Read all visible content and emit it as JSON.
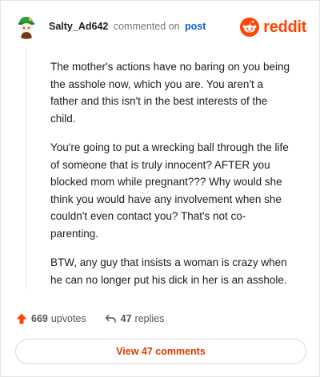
{
  "header": {
    "username": "Salty_Ad642",
    "action_text": "commented on",
    "link_text": "post",
    "brand_name": "reddit",
    "brand_color": "#ff4500"
  },
  "comment": {
    "paragraphs": [
      "The mother's actions have no baring on you being the asshole now, which you are. You aren't a father and this isn't in the best interests of the child.",
      "You're going to put a wrecking ball through the life of someone that is truly innocent? AFTER you blocked mom while pregnant??? Why would she think you would have any involvement when she couldn't even contact you? That's not co-parenting.",
      "BTW, any guy that insists a woman is crazy when he can no longer put his dick in her is an asshole."
    ]
  },
  "footer": {
    "upvote_icon": "upvote-arrow-icon",
    "upvotes_count": "669",
    "upvotes_label": "upvotes",
    "reply_icon": "reply-arrow-icon",
    "replies_count": "47",
    "replies_label": "replies",
    "view_comments_label": "View 47 comments",
    "view_comments_color": "#d93a00"
  }
}
